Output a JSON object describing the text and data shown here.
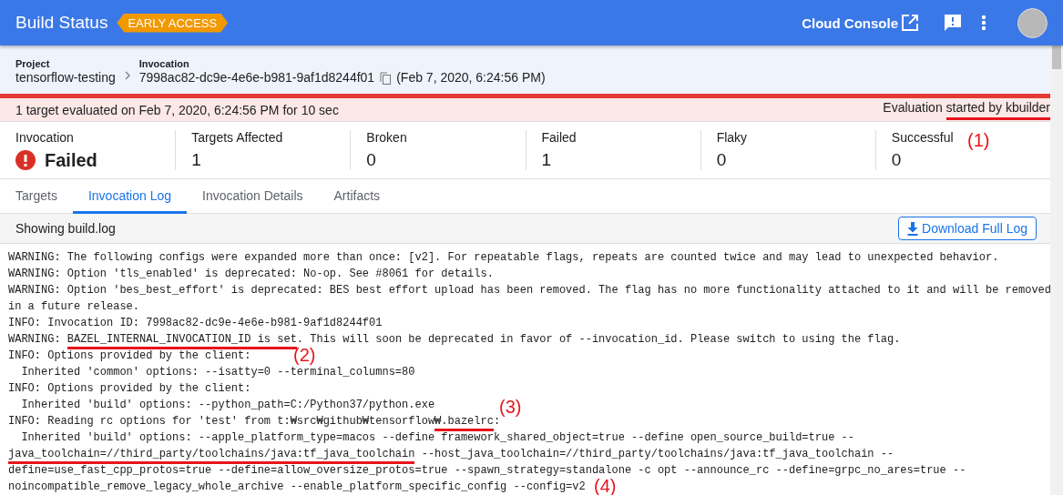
{
  "header": {
    "title": "Build Status",
    "badge": "EARLY ACCESS",
    "console_link": "Cloud Console"
  },
  "breadcrumb": {
    "project_label": "Project",
    "project": "tensorflow-testing",
    "invocation_label": "Invocation",
    "invocation_id": "7998ac82-dc9e-4e6e-b981-9af1d8244f01",
    "invocation_time": "(Feb 7, 2020, 6:24:56 PM)"
  },
  "status_bar": {
    "summary": "1 target evaluated on Feb 7, 2020, 6:24:56 PM for 10 sec",
    "started_by": [
      {
        "text": "Evaluation ",
        "marked": false
      },
      {
        "text": "started by kbuilder",
        "marked": true
      }
    ]
  },
  "summary": [
    {
      "kind": "status",
      "label": "Invocation",
      "value": "Failed"
    },
    {
      "kind": "count",
      "label": "Targets Affected",
      "value": "1"
    },
    {
      "kind": "count",
      "label": "Broken",
      "value": "0"
    },
    {
      "kind": "count",
      "label": "Failed",
      "value": "1"
    },
    {
      "kind": "count",
      "label": "Flaky",
      "value": "0"
    },
    {
      "kind": "count",
      "label": "Successful",
      "value": "0"
    }
  ],
  "tabs": [
    {
      "label": "Targets",
      "selected": false
    },
    {
      "label": "Invocation Log",
      "selected": true
    },
    {
      "label": "Invocation Details",
      "selected": false
    },
    {
      "label": "Artifacts",
      "selected": false
    }
  ],
  "log": {
    "title": "Showing build.log",
    "download_button": "Download Full Log",
    "lines": [
      [
        {
          "text": "WARNING: The following configs were expanded more than once: [v2]. For repeatable flags, repeats are counted twice and may lead to unexpected behavior.",
          "marked": false
        }
      ],
      [
        {
          "text": "WARNING: Option 'tls_enabled' is deprecated: No-op. See #8061 for details.",
          "marked": false
        }
      ],
      [
        {
          "text": "WARNING: Option 'bes_best_effort' is deprecated: BES best effort upload has been removed. The flag has no more functionality attached to it and will be removed",
          "marked": false
        }
      ],
      [
        {
          "text": "in a future release.",
          "marked": false
        }
      ],
      [
        {
          "text": "INFO: Invocation ID: 7998ac82-dc9e-4e6e-b981-9af1d8244f01",
          "marked": false
        }
      ],
      [
        {
          "text": "WARNING: ",
          "marked": false
        },
        {
          "text": "BAZEL_INTERNAL_INVOCATION_ID is set",
          "marked": true
        },
        {
          "text": ". This will soon be deprecated in favor of --invocation_id. Please switch to using the flag.",
          "marked": false
        }
      ],
      [
        {
          "text": "INFO: Options provided by the client:",
          "marked": false
        }
      ],
      [
        {
          "text": "  Inherited 'common' options: --isatty=0 --terminal_columns=80",
          "marked": false
        }
      ],
      [
        {
          "text": "INFO: Options provided by the client:",
          "marked": false
        }
      ],
      [
        {
          "text": "  Inherited 'build' options: --python_path=C:/Python37/python.exe",
          "marked": false
        }
      ],
      [
        {
          "text": "INFO: Reading rc options for 'test' from t:₩src₩github₩tensorflow",
          "marked": false
        },
        {
          "text": "₩.bazelrc",
          "marked": true
        },
        {
          "text": ":",
          "marked": false
        }
      ],
      [
        {
          "text": "  Inherited 'build' options: --apple_platform_type=macos --define framework_shared_object=true --define open_source_build=true --",
          "marked": false
        }
      ],
      [
        {
          "text": "java_toolchain=//third_party/toolchains/java:tf_java_toolchain",
          "marked": true
        },
        {
          "text": " --host_java_toolchain=//third_party/toolchains/java:tf_java_toolchain --",
          "marked": false
        }
      ],
      [
        {
          "text": "define=use_fast_cpp_protos=true --define=allow_oversize_protos=true --spawn_strategy=standalone -c opt --announce_rc --define=grpc_no_ares=true --",
          "marked": false
        }
      ],
      [
        {
          "text": "noincompatible_remove_legacy_whole_archive --enable_platform_specific_config --config=v2",
          "marked": false
        }
      ]
    ]
  },
  "annotations": [
    {
      "label": "(1)"
    },
    {
      "label": "(2)"
    },
    {
      "label": "(3)"
    },
    {
      "label": "(4)"
    }
  ]
}
